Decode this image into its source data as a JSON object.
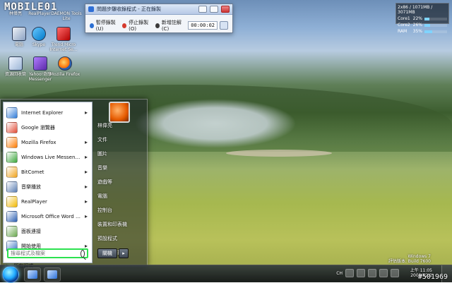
{
  "brand_text": "MOBILE01",
  "desktop_icons": [
    {
      "label": "電腦"
    },
    {
      "label": "Skype"
    },
    {
      "label": "Trend Micro Internet Se..."
    },
    {
      "label": "資源回收筒"
    },
    {
      "label": "Yahoo!奇摩 Messenger"
    },
    {
      "label": "Mozilla Firefox"
    },
    {
      "label": "林偉亮"
    },
    {
      "label": "RealPlayer"
    },
    {
      "label": "DAEMON Tools Lite"
    }
  ],
  "recorder": {
    "title": "問題步驟收錄程式 - 正在錄製",
    "pause_label": "暫停錄製(U)",
    "stop_label": "停止錄製(O)",
    "add_comment_label": "新增註解(C)",
    "timer": "00:00:02"
  },
  "system_monitor": {
    "header": "2x86 / 1071MB / 3071MB",
    "rows": [
      {
        "label": "Core1",
        "value": "22%",
        "pct": 22
      },
      {
        "label": "Core2",
        "value": "26%",
        "pct": 26
      },
      {
        "label": "RAM",
        "value": "35%",
        "pct": 35
      }
    ]
  },
  "start_menu": {
    "pinned": [
      {
        "label": "Internet Explorer",
        "has_arrow": true,
        "color": "#2f7bd8"
      },
      {
        "label": "Google 瀏覽器",
        "has_arrow": false,
        "color": "#e24b35"
      },
      {
        "label": "Mozilla Firefox",
        "has_arrow": true,
        "color": "#ff7a00"
      },
      {
        "label": "Windows Live Messenger",
        "has_arrow": true,
        "color": "#3aa63a"
      },
      {
        "label": "BitComet",
        "has_arrow": true,
        "color": "#f0a21b"
      },
      {
        "label": "音樂播放",
        "has_arrow": true,
        "color": "#5a7db2"
      },
      {
        "label": "RealPlayer",
        "has_arrow": true,
        "color": "#f2b900"
      },
      {
        "label": "Microsoft Office Word 2007",
        "has_arrow": true,
        "color": "#2b5fb2"
      },
      {
        "label": "面板連接",
        "has_arrow": false,
        "color": "#6aa84f"
      },
      {
        "label": "開始使用",
        "has_arrow": true,
        "color": "#3b73c6"
      }
    ],
    "all_programs_label": "所有程式",
    "search_placeholder": "搜尋程式及檔案",
    "right_items": [
      "林偉亮",
      "文件",
      "圖片",
      "音樂",
      "遊戲等",
      "電腦",
      "控制台",
      "裝置和印表機",
      "預設程式",
      "說明及支援"
    ],
    "shutdown_label": "關機"
  },
  "taskbar": {
    "tray_lang": "CH",
    "clock": "上午 11:05",
    "date": "2009/12/1",
    "windows_text": "Windows 7",
    "windows_build": "評估版本. Build 7600",
    "watermark": "#501969"
  }
}
